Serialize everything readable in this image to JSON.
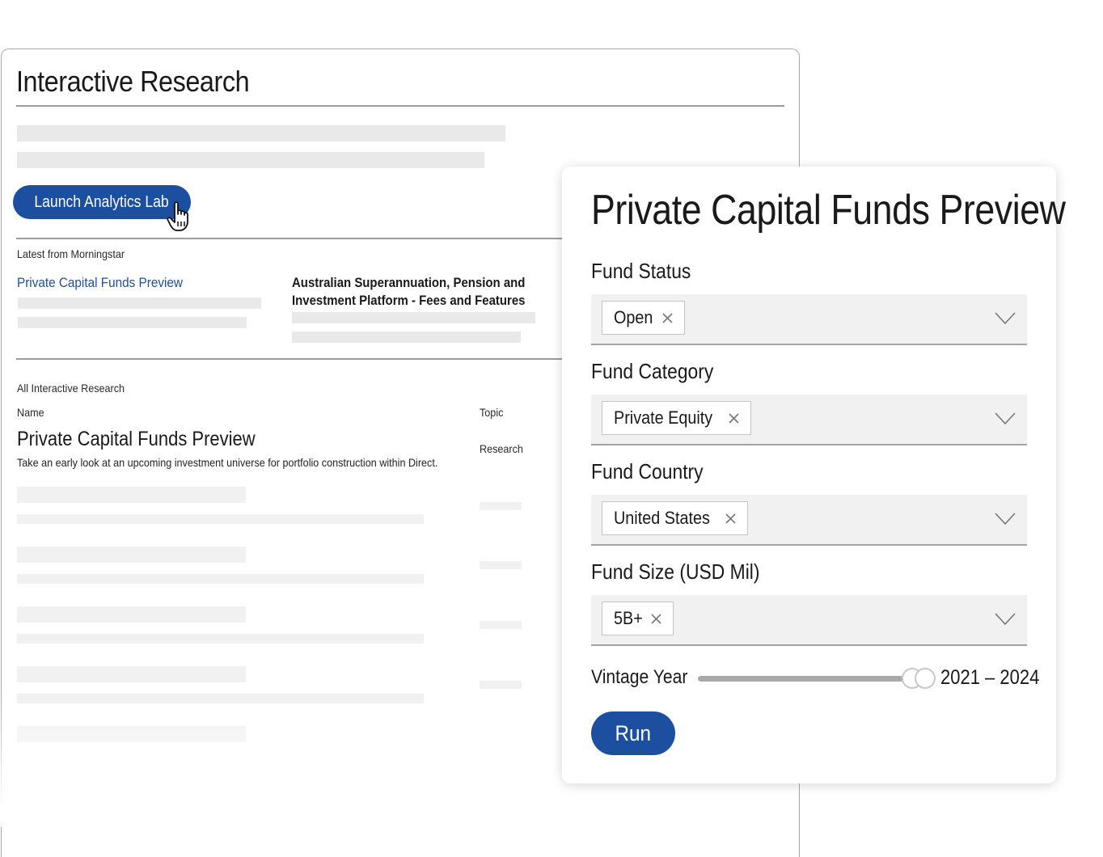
{
  "research": {
    "page_title": "Interactive Research",
    "launch_button": "Launch Analytics Lab",
    "latest_heading": "Latest from Morningstar",
    "latest_link": "Private Capital Funds Preview",
    "latest_article": "Australian Superannuation, Pension and Investment Platform -  Fees and Features",
    "all_heading": "All Interactive Research",
    "col_name": "Name",
    "col_topic": "Topic",
    "row": {
      "title": "Private Capital Funds Preview",
      "description": "Take an early look at an upcoming investment universe for portfolio construction within Direct.",
      "topic": "Research"
    }
  },
  "panel": {
    "title": "Private Capital Funds Preview",
    "fields": [
      {
        "label": "Fund Status",
        "chip": "Open"
      },
      {
        "label": "Fund Category",
        "chip": "Private Equity"
      },
      {
        "label": "Fund Country",
        "chip": "United States"
      },
      {
        "label": "Fund Size (USD Mil)",
        "chip": "5B+"
      }
    ],
    "vintage_label": "Vintage Year",
    "vintage_range": "2021 – 2024",
    "run_label": "Run"
  },
  "colors": {
    "brand_blue": "#1d4fa0",
    "select_bg": "#f1f1f1",
    "skeleton": "#e9e9e9"
  },
  "icons": {
    "cursor": "hand-pointer-icon",
    "chip_remove": "close-icon",
    "select": "chevron-down-icon"
  }
}
